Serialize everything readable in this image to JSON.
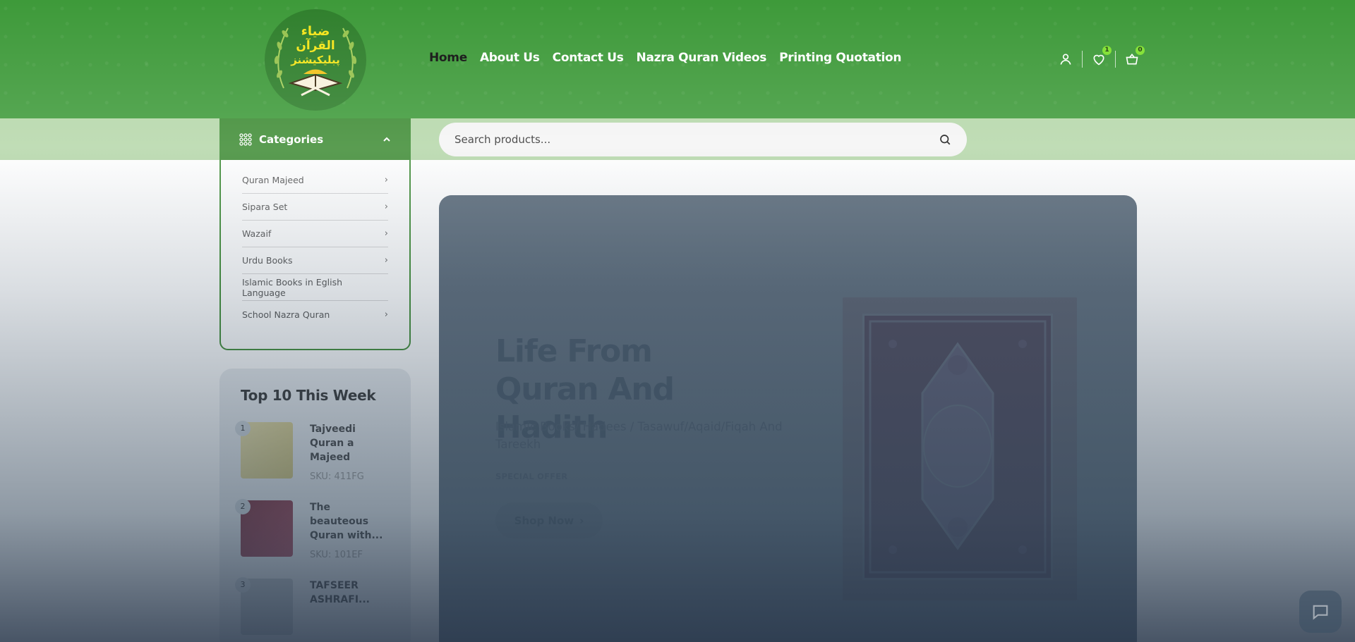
{
  "header": {
    "logo_alt": "ضیاء القرآن پبلیکیشنز",
    "nav": [
      {
        "label": "Home",
        "active": true
      },
      {
        "label": "About Us"
      },
      {
        "label": "Contact Us"
      },
      {
        "label": "Nazra Quran Videos"
      },
      {
        "label": "Printing Quotation"
      }
    ],
    "icons": {
      "account": "user-icon",
      "wishlist": "heart-icon",
      "cart": "basket-icon"
    },
    "wishlist_count": "1",
    "cart_count": "0",
    "brand_color": "#3e9a3a",
    "badge_color": "#7fe02f"
  },
  "search": {
    "placeholder": "Search products..."
  },
  "categories": {
    "title": "Categories",
    "items": [
      {
        "label": "Quran Majeed",
        "has_children": true
      },
      {
        "label": "Sipara Set",
        "has_children": true
      },
      {
        "label": "Wazaif",
        "has_children": true
      },
      {
        "label": "Urdu Books",
        "has_children": true
      },
      {
        "label": "Islamic Books in Eglish Language",
        "has_children": false
      },
      {
        "label": "School Nazra Quran",
        "has_children": true
      }
    ]
  },
  "top10": {
    "title": "Top 10 This Week",
    "items": [
      {
        "rank": "1",
        "name": "Tajveedi Quran a Majeed",
        "sku": "SKU: 411FG"
      },
      {
        "rank": "2",
        "name": "The beauteous Quran with...",
        "sku": "SKU: 101EF"
      },
      {
        "rank": "3",
        "name": "TAFSEER ASHRAFI...",
        "sku": ""
      }
    ]
  },
  "hero": {
    "title": "Life From Quran And Hadith",
    "subtitle": "Islamic Books/ Hadees / Tasawuf/Aqaid/Fiqah And Tareekh",
    "offer": "SPECIAL OFFER",
    "cta": "Shop Now"
  }
}
